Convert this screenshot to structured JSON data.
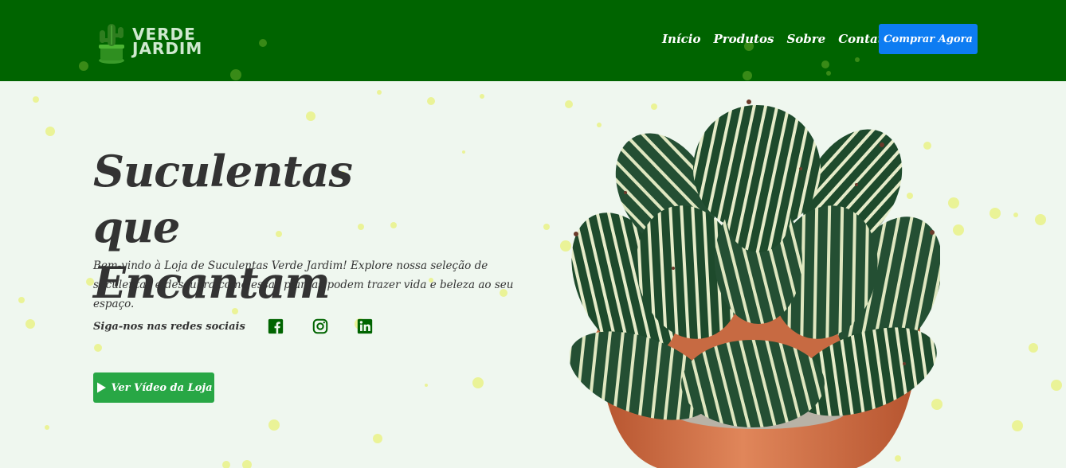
{
  "brand": {
    "line1": "VERDE",
    "line2": "JARDIM"
  },
  "nav": {
    "items": [
      {
        "label": "Início"
      },
      {
        "label": "Produtos"
      },
      {
        "label": "Sobre"
      },
      {
        "label": "Contato"
      }
    ],
    "cta_label": "Comprar Agora"
  },
  "hero": {
    "title_line1": "Suculentas que",
    "title_line2": "Encantam",
    "description": "Bem-vindo à Loja de Suculentas Verde Jardim! Explore nossa seleção de suculentas e descubra como essas plantas podem trazer vida e beleza ao seu espaço.",
    "social_label": "Siga-nos nas redes sociais",
    "social_icons": [
      "facebook-icon",
      "instagram-icon",
      "linkedin-icon"
    ],
    "video_button_label": "Ver Vídeo da Loja"
  },
  "colors": {
    "header_bg": "#006400",
    "page_bg": "#eff7ef",
    "cta_blue": "#0d7cf2",
    "video_green": "#28a745",
    "icon_green": "#006400",
    "text_dark": "#333333"
  }
}
